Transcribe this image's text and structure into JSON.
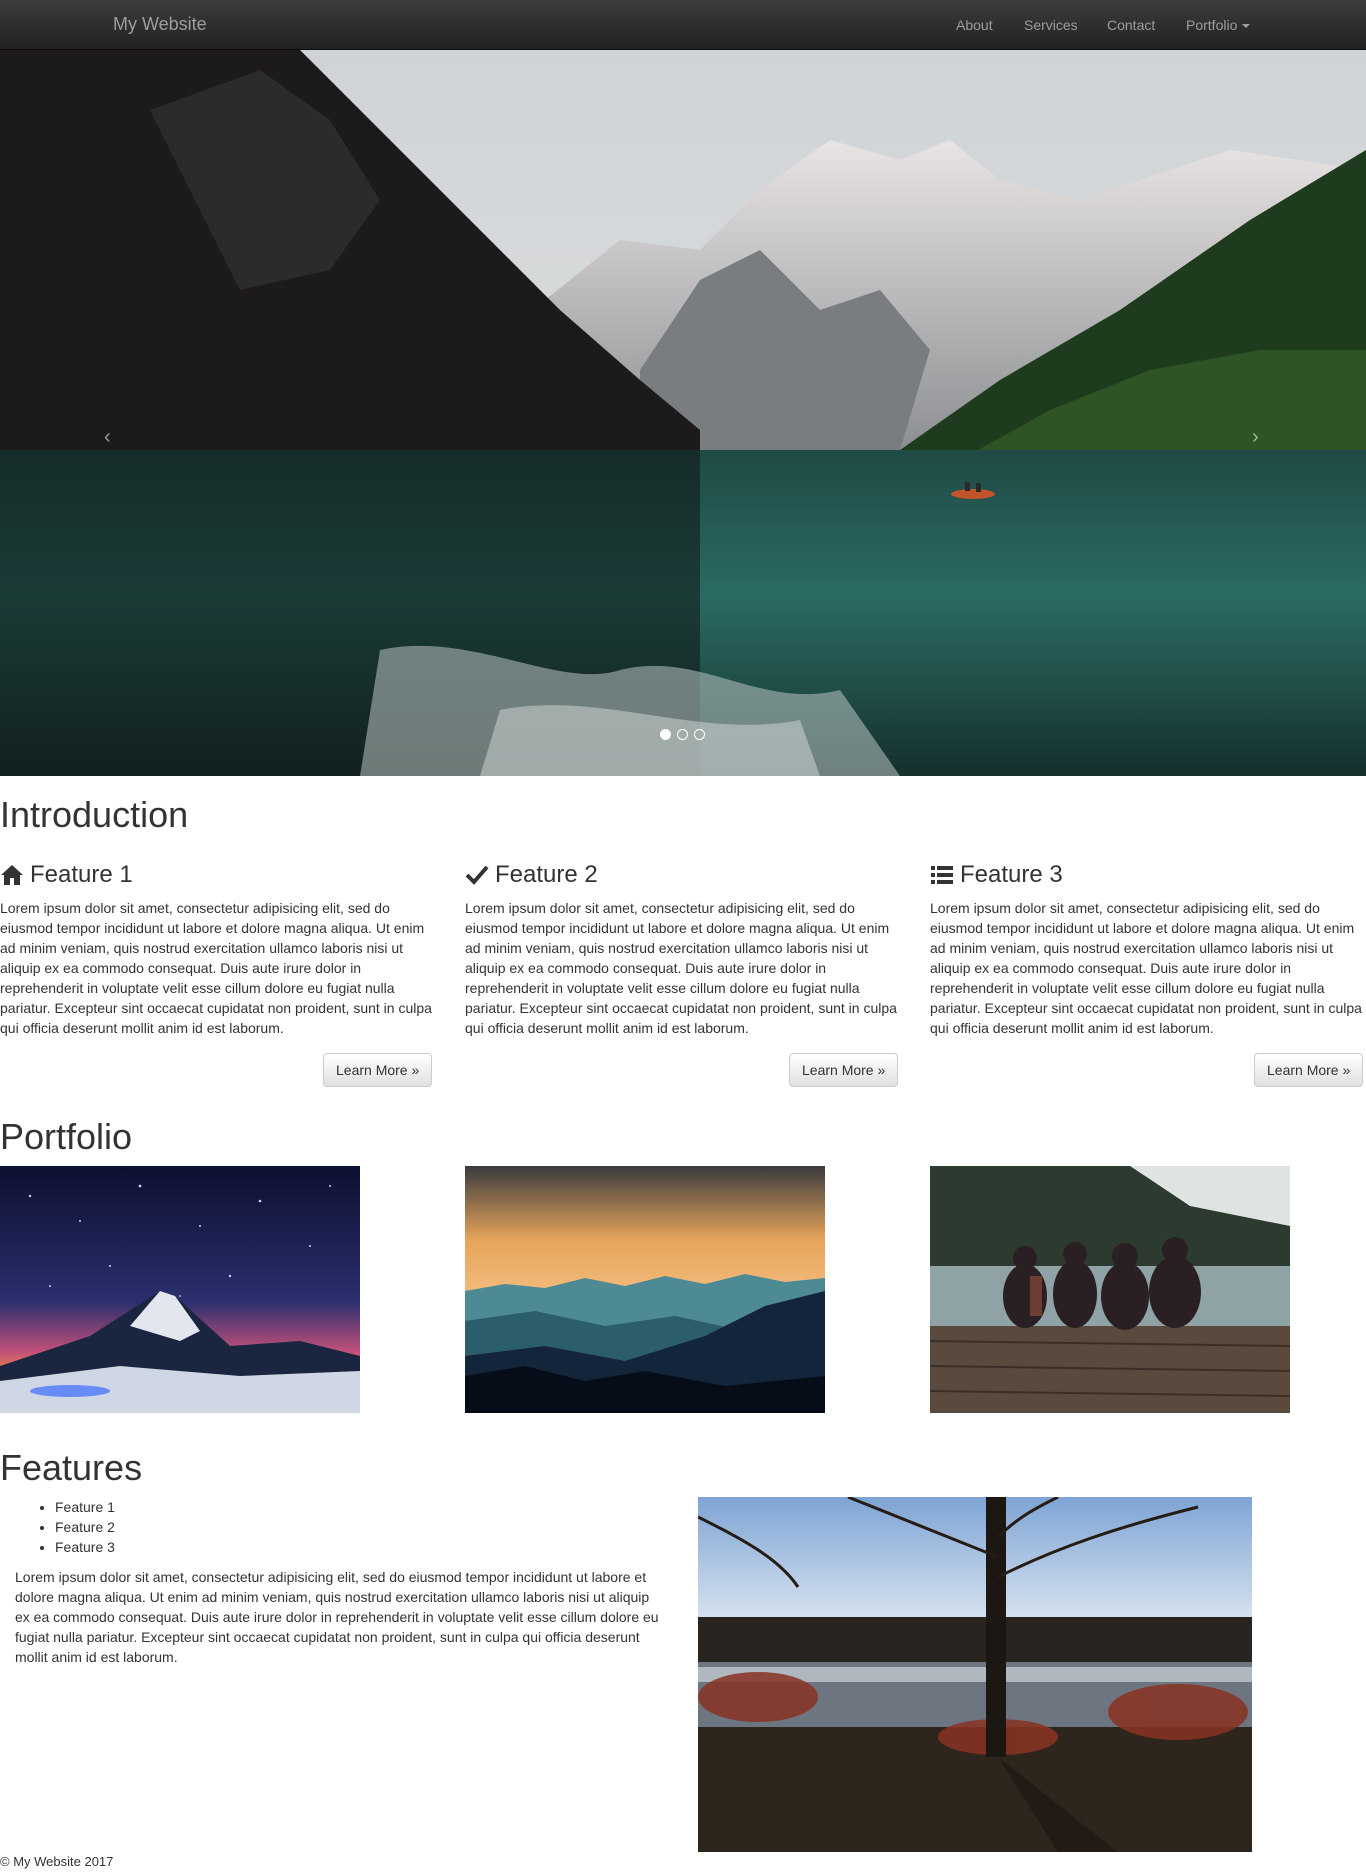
{
  "navbar": {
    "brand": "My Website",
    "links": [
      "About",
      "Services",
      "Contact"
    ],
    "dropdown_label": "Portfolio"
  },
  "carousel": {
    "prev_glyph": "‹",
    "next_glyph": "›",
    "slide_count": 3,
    "active_index": 0,
    "image": "mountain-lake-with-boat"
  },
  "introduction": {
    "title": "Introduction",
    "features": [
      {
        "icon": "home-icon",
        "title": "Feature 1",
        "text": "Lorem ipsum dolor sit amet, consectetur adipisicing elit, sed do eiusmod tempor incididunt ut labore et dolore magna aliqua. Ut enim ad minim veniam, quis nostrud exercitation ullamco laboris nisi ut aliquip ex ea commodo consequat. Duis aute irure dolor in reprehenderit in voluptate velit esse cillum dolore eu fugiat nulla pariatur. Excepteur sint occaecat cupidatat non proident, sunt in culpa qui officia deserunt mollit anim id est laborum.",
        "button": "Learn More »"
      },
      {
        "icon": "checkmark-icon",
        "title": "Feature 2",
        "text": "Lorem ipsum dolor sit amet, consectetur adipisicing elit, sed do eiusmod tempor incididunt ut labore et dolore magna aliqua. Ut enim ad minim veniam, quis nostrud exercitation ullamco laboris nisi ut aliquip ex ea commodo consequat. Duis aute irure dolor in reprehenderit in voluptate velit esse cillum dolore eu fugiat nulla pariatur. Excepteur sint occaecat cupidatat non proident, sunt in culpa qui officia deserunt mollit anim id est laborum.",
        "button": "Learn More »"
      },
      {
        "icon": "list-icon",
        "title": "Feature 3",
        "text": "Lorem ipsum dolor sit amet, consectetur adipisicing elit, sed do eiusmod tempor incididunt ut labore et dolore magna aliqua. Ut enim ad minim veniam, quis nostrud exercitation ullamco laboris nisi ut aliquip ex ea commodo consequat. Duis aute irure dolor in reprehenderit in voluptate velit esse cillum dolore eu fugiat nulla pariatur. Excepteur sint occaecat cupidatat non proident, sunt in culpa qui officia deserunt mollit anim id est laborum.",
        "button": "Learn More »"
      }
    ]
  },
  "portfolio": {
    "title": "Portfolio",
    "images": [
      "starry-mountain-peak",
      "sunset-mountain-ranges",
      "friends-on-lake-dock"
    ]
  },
  "features": {
    "title": "Features",
    "items": [
      "Feature 1",
      "Feature 2",
      "Feature 3"
    ],
    "text": "Lorem ipsum dolor sit amet, consectetur adipisicing elit, sed do eiusmod tempor incididunt ut labore et dolore magna aliqua. Ut enim ad minim veniam, quis nostrud exercitation ullamco laboris nisi ut aliquip ex ea commodo consequat. Duis aute irure dolor in reprehenderit in voluptate velit esse cillum dolore eu fugiat nulla pariatur. Excepteur sint occaecat cupidatat non proident, sunt in culpa qui officia deserunt mollit anim id est laborum.",
    "image": "tree-by-lake-sunset"
  },
  "footer": {
    "text": "© My Website 2017"
  },
  "colors": {
    "navbar_bg": "#222222",
    "nav_text": "#9d9d9d",
    "body_text": "#333333",
    "button_border": "#cccccc"
  }
}
